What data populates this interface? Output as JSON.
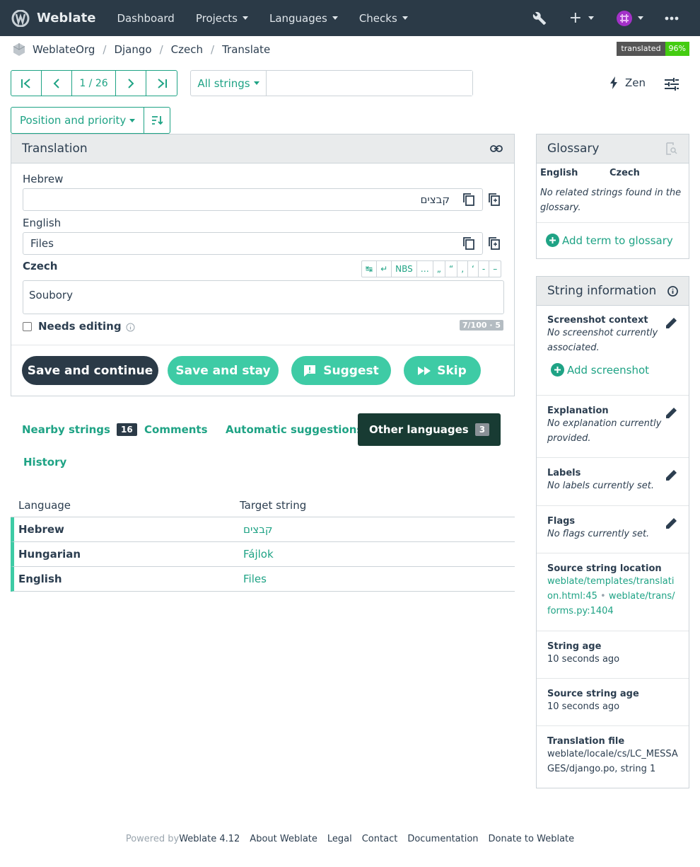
{
  "nav": {
    "brand": "Weblate",
    "items": [
      "Dashboard",
      "Projects",
      "Languages",
      "Checks"
    ]
  },
  "breadcrumb": [
    "WeblateOrg",
    "Django",
    "Czech",
    "Translate"
  ],
  "badge": {
    "label": "translated",
    "value": "96%"
  },
  "pager": {
    "position": "1 / 26"
  },
  "filter": {
    "label": "All strings",
    "search_value": ""
  },
  "zen_label": "Zen",
  "sort_label": "Position and priority",
  "translation": {
    "title": "Translation",
    "source_lang": "Hebrew",
    "source_text": "קבצים",
    "english_label": "English",
    "english_text": "Files",
    "target_lang": "Czech",
    "target_text": "Soubory",
    "toolbar": [
      "↹",
      "↵",
      "NBS",
      "…",
      "„",
      "“",
      "‚",
      "‘",
      "-",
      "–"
    ],
    "needs_editing": "Needs editing",
    "counter": "7/100 · 5",
    "buttons": {
      "save_continue": "Save and continue",
      "save_stay": "Save and stay",
      "suggest": "Suggest",
      "skip": "Skip"
    }
  },
  "tabs": {
    "nearby": "Nearby strings",
    "nearby_count": "16",
    "comments": "Comments",
    "automatic": "Automatic suggestions",
    "other": "Other languages",
    "other_count": "3",
    "history": "History"
  },
  "other_languages": {
    "headers": [
      "Language",
      "Target string"
    ],
    "rows": [
      {
        "lang": "Hebrew",
        "text": "קבצים"
      },
      {
        "lang": "Hungarian",
        "text": "Fájlok"
      },
      {
        "lang": "English",
        "text": "Files"
      }
    ]
  },
  "glossary": {
    "title": "Glossary",
    "col_source": "English",
    "col_target": "Czech",
    "empty": "No related strings found in the glossary.",
    "add": "Add term to glossary"
  },
  "string_info": {
    "title": "String information",
    "screenshot_h": "Screenshot context",
    "screenshot_v": "No screenshot currently associated.",
    "screenshot_add": "Add screenshot",
    "explanation_h": "Explanation",
    "explanation_v": "No explanation currently provided.",
    "labels_h": "Labels",
    "labels_v": "No labels currently set.",
    "flags_h": "Flags",
    "flags_v": "No flags currently set.",
    "location_h": "Source string location",
    "location_1": "weblate/templates/translation.html:45",
    "location_2": "weblate/trans/forms.py:1404",
    "age_h": "String age",
    "age_v": "10 seconds ago",
    "src_age_h": "Source string age",
    "src_age_v": "10 seconds ago",
    "file_h": "Translation file",
    "file_v": "weblate/locale/cs/LC_MESSAGES/django.po, string 1"
  },
  "footer": {
    "powered": "Powered by",
    "version": "Weblate 4.12",
    "links": [
      "About Weblate",
      "Legal",
      "Contact",
      "Documentation",
      "Donate to Weblate"
    ]
  },
  "colors": {
    "accent": "#1fa385",
    "navbar": "#2b3a47",
    "button_teal": "#3ecba5",
    "badge_green": "#44cc11"
  }
}
